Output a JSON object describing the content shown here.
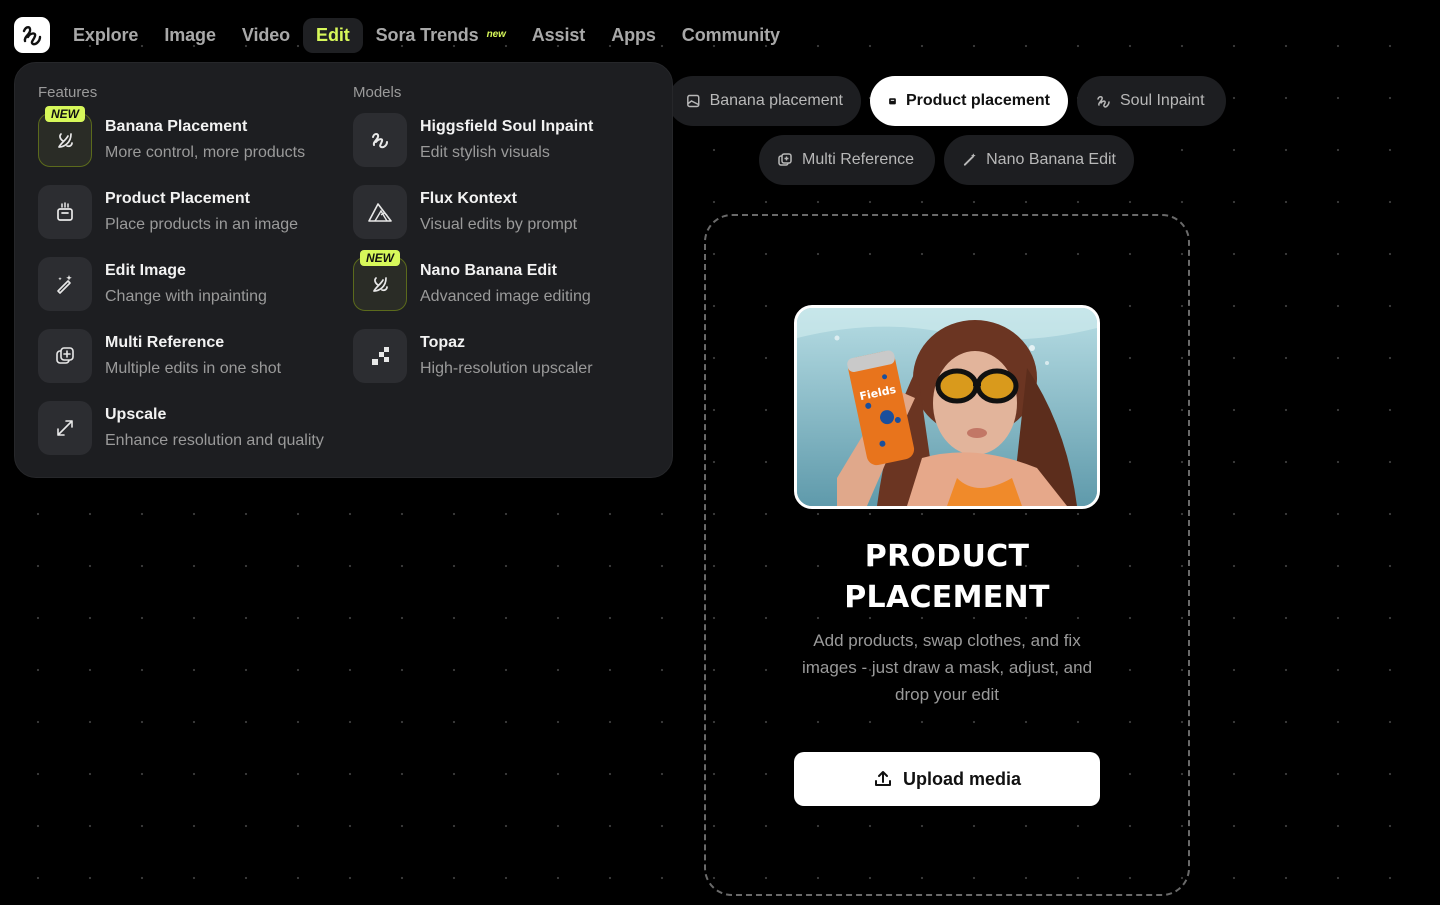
{
  "nav": {
    "items": [
      {
        "label": "Explore"
      },
      {
        "label": "Image"
      },
      {
        "label": "Video"
      },
      {
        "label": "Edit"
      },
      {
        "label": "Sora Trends",
        "badge": "new"
      },
      {
        "label": "Assist"
      },
      {
        "label": "Apps"
      },
      {
        "label": "Community"
      }
    ]
  },
  "menu": {
    "features_title": "Features",
    "models_title": "Models",
    "new_tag": "NEW",
    "features": [
      {
        "title": "Banana Placement",
        "subtitle": "More control, more products",
        "icon": "banana-icon"
      },
      {
        "title": "Product Placement",
        "subtitle": "Place products in an image",
        "icon": "product-box-icon"
      },
      {
        "title": "Edit Image",
        "subtitle": "Change with inpainting",
        "icon": "brush-icon"
      },
      {
        "title": "Multi Reference",
        "subtitle": "Multiple edits in one shot",
        "icon": "multi-layer-icon"
      },
      {
        "title": "Upscale",
        "subtitle": "Enhance resolution and quality",
        "icon": "expand-arrows-icon"
      }
    ],
    "models": [
      {
        "title": "Higgsfield Soul Inpaint",
        "subtitle": "Edit stylish visuals",
        "icon": "higgsfield-logo-icon"
      },
      {
        "title": "Flux Kontext",
        "subtitle": "Visual edits by prompt",
        "icon": "flux-triangle-icon"
      },
      {
        "title": "Nano Banana Edit",
        "subtitle": "Advanced image editing",
        "icon": "banana-icon"
      },
      {
        "title": "Topaz",
        "subtitle": "High-resolution upscaler",
        "icon": "topaz-pixel-icon"
      }
    ]
  },
  "modes": {
    "banana": "Banana placement",
    "product": "Product placement",
    "soul": "Soul Inpaint",
    "multi": "Multi Reference",
    "nano": "Nano Banana Edit"
  },
  "card": {
    "title_line1": "PRODUCT",
    "title_line2": "PLACEMENT",
    "desc_line1": "Add products, swap clothes, and fix",
    "desc_line2": "images - just draw a mask, adjust, and",
    "desc_line3": "drop your edit",
    "upload_label": "Upload media",
    "can_text": "Fields"
  },
  "colors": {
    "accent": "#d7f85a",
    "panel": "#1d1e21",
    "background": "#000000"
  }
}
